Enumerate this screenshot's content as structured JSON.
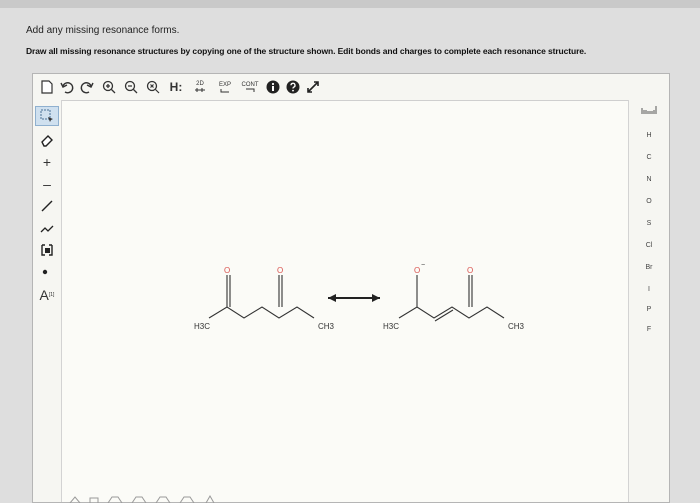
{
  "header": {
    "prompt": "Add any missing resonance forms.",
    "instruction": "Draw all missing resonance structures by copying one of the structure shown. Edit bonds and charges to complete each resonance structure."
  },
  "toolbar": {
    "hydrogen_label": "H:",
    "twoD_label": "2D",
    "exp_label": "EXP",
    "cont_label": "CONT"
  },
  "left_tools": {
    "atom_label": "A",
    "atom_superscript": "[1]"
  },
  "elements": [
    "H",
    "C",
    "N",
    "O",
    "S",
    "Cl",
    "Br",
    "I",
    "P",
    "F"
  ],
  "molecules": {
    "left": {
      "methyl_left": "H3C",
      "methyl_right": "CH3",
      "oxygen_1": "O",
      "oxygen_2": "O"
    },
    "right": {
      "methyl_left": "H3C",
      "methyl_right": "CH3",
      "oxygen_1": "O",
      "oxygen_2": "O",
      "charge": "−"
    }
  },
  "colors": {
    "selected_tool": "#cfe0ef",
    "canvas_bg": "#fbfbf7",
    "atom_o": "#d9534f"
  }
}
